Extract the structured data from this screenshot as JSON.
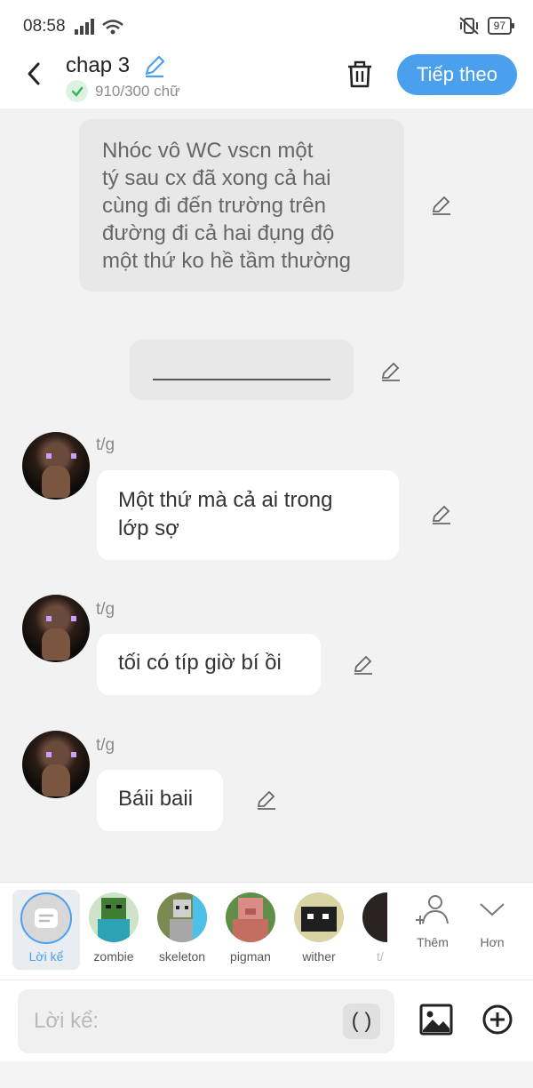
{
  "status_bar": {
    "time": "08:58",
    "battery": "97"
  },
  "header": {
    "title": "chap 3",
    "word_count": "910/300 chữ",
    "next_button": "Tiếp theo"
  },
  "messages": [
    {
      "type": "narration",
      "text": "Nhóc vô WC vscn một\ntý sau cx đã xong cả hai\ncùng đi đến trường  trên\nđường đi cả hai đụng độ\nmột thứ ko hề tầm thường"
    },
    {
      "type": "divider"
    },
    {
      "type": "speech",
      "speaker": "t/g",
      "text": "Một thứ mà cả ai trong\nlớp sợ"
    },
    {
      "type": "speech",
      "speaker": "t/g",
      "text": "tối có típ giờ bí ồi"
    },
    {
      "type": "speech",
      "speaker": "t/g",
      "text": "Báii baii"
    }
  ],
  "characters": {
    "narrator": "Lời kể",
    "items": [
      "zombie",
      "skeleton",
      "pigman",
      "wither",
      "t/"
    ],
    "add_label": "Thêm",
    "more_label": "Hơn"
  },
  "input": {
    "placeholder": "Lời kể:",
    "paren_button": "( )"
  }
}
